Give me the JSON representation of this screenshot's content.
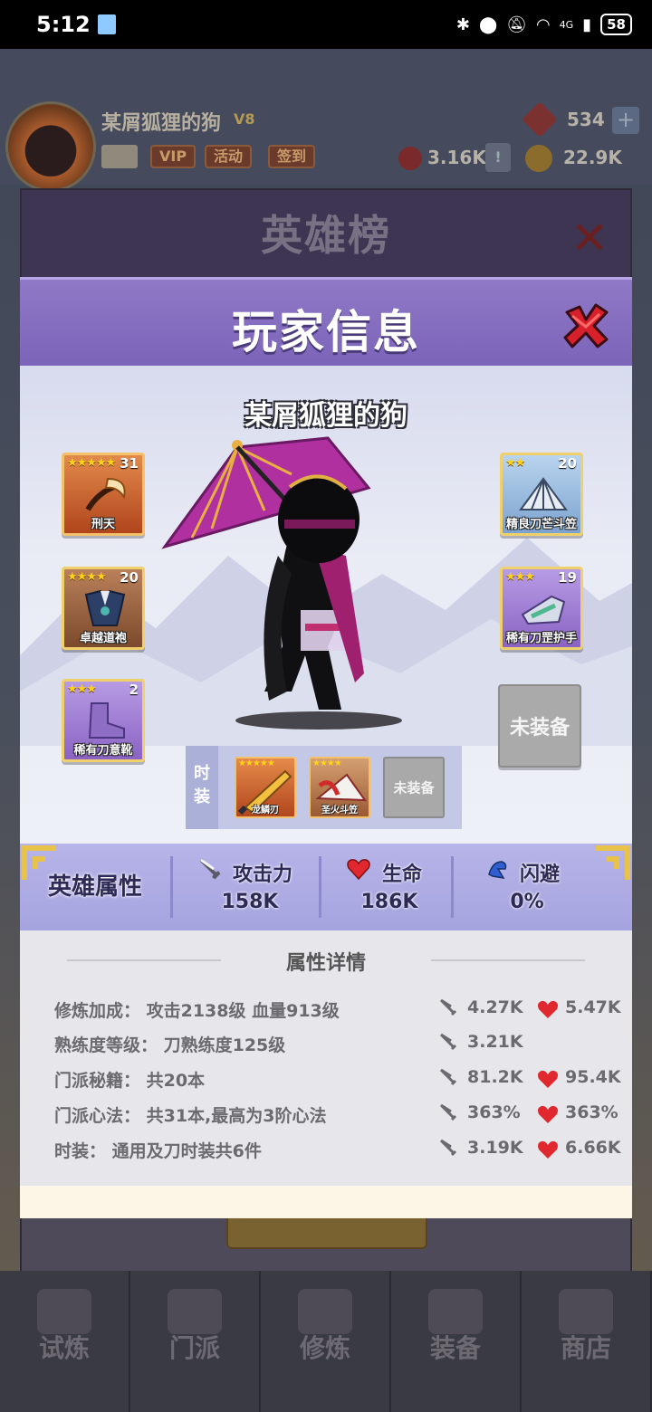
{
  "status_bar": {
    "time": "5:12",
    "battery": "58",
    "network": "4G"
  },
  "background": {
    "player_name": "某屑狐狸的狗",
    "vip_level": "V8",
    "buttons": [
      "VIP",
      "活动",
      "签到"
    ],
    "gems": "534",
    "plus": "+",
    "token": "3.16K",
    "coins": "22.9K",
    "leaderboard_title": "英雄榜",
    "nav": [
      "试炼",
      "门派",
      "修炼",
      "装备",
      "商店"
    ]
  },
  "modal": {
    "title": "玩家信息",
    "player_name": "某屑狐狸的狗",
    "left_slots": [
      {
        "name": "刑天",
        "stars": "★★★★★",
        "level": "31",
        "rarity": "orange"
      },
      {
        "name": "卓越道袍",
        "stars": "★★★★",
        "level": "20",
        "rarity": "brown"
      },
      {
        "name": "稀有刀意靴",
        "stars": "★★★",
        "level": "2",
        "rarity": "purple"
      }
    ],
    "right_slots": [
      {
        "name": "精良刀芒斗笠",
        "stars": "★★",
        "level": "20",
        "rarity": "blue"
      },
      {
        "name": "稀有刀罡护手",
        "stars": "★★★",
        "level": "19",
        "rarity": "purple"
      }
    ],
    "unequipped_label": "未装备",
    "costume": {
      "label": "时装",
      "items": [
        {
          "name": "龙鳞刃",
          "stars": "★★★★★"
        },
        {
          "name": "圣火斗笠",
          "stars": "★★★★"
        }
      ],
      "empty_label": "未装备"
    },
    "stats": {
      "title": "英雄属性",
      "attack_label": "攻击力",
      "attack_value": "158K",
      "hp_label": "生命",
      "hp_value": "186K",
      "dodge_label": "闪避",
      "dodge_value": "0%"
    },
    "details": {
      "title": "属性详情",
      "rows": [
        {
          "label": "修炼加成：  攻击2138级 血量913级",
          "atk": "4.27K",
          "hp": "5.47K"
        },
        {
          "label": "熟练度等级：  刀熟练度125级",
          "atk": "3.21K",
          "hp": ""
        },
        {
          "label": "门派秘籍：  共20本",
          "atk": "81.2K",
          "hp": "95.4K"
        },
        {
          "label": "门派心法：  共31本,最高为3阶心法",
          "atk": "363%",
          "hp": "363%"
        },
        {
          "label": "时装：  通用及刀时装共6件",
          "atk": "3.19K",
          "hp": "6.66K"
        }
      ]
    }
  },
  "colors": {
    "header_purple": "#8f79c6",
    "stats_purple": "#b6b4e8",
    "heart_red": "#e0282e"
  }
}
